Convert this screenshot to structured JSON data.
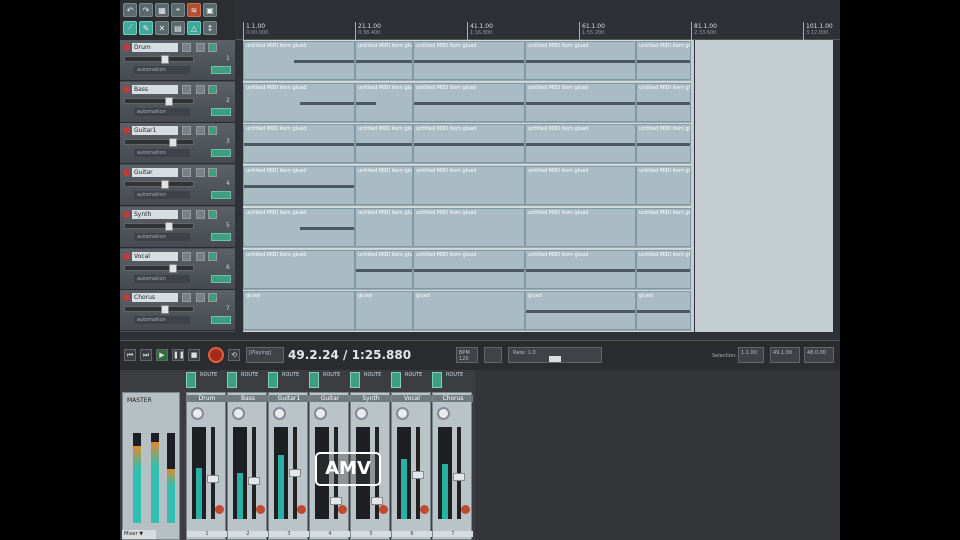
{
  "ruler": {
    "marks": [
      {
        "label": "1.1.00",
        "sub": "0:00.000"
      },
      {
        "label": "21.1.00",
        "sub": "0:38.400"
      },
      {
        "label": "41.1.00",
        "sub": "1:16.800"
      },
      {
        "label": "61.1.00",
        "sub": "1:55.200"
      },
      {
        "label": "81.1.00",
        "sub": "2:33.600"
      },
      {
        "label": "101.1.00",
        "sub": "3:12.000"
      }
    ]
  },
  "tracks": [
    {
      "name": "Drum",
      "num": "1",
      "io": "automation"
    },
    {
      "name": "Bass",
      "num": "2",
      "io": "automation"
    },
    {
      "name": "Guitar1",
      "num": "3",
      "io": "automation"
    },
    {
      "name": "Guitar",
      "num": "4",
      "io": "automation"
    },
    {
      "name": "Synth",
      "num": "5",
      "io": "automation"
    },
    {
      "name": "Vocal",
      "num": "6",
      "io": "automation"
    },
    {
      "name": "Chorus",
      "num": "7",
      "io": "automation"
    }
  ],
  "item_label": "untitled MIDI item glued",
  "chorus_item_label": "glued",
  "transport": {
    "time": "49.2.24 / 1:25.880",
    "state": "[Playing]",
    "bpm_label": "BPM 120",
    "rate_label": "Rate: 1.0",
    "selection_label": "Selection:",
    "selection_values": [
      "1.1.00",
      "49.1.00",
      "48.0.00"
    ]
  },
  "mixer": {
    "master_label": "MASTER",
    "strip_top_label": "ROUTE",
    "strips": [
      {
        "name": "Drum",
        "num": "1",
        "level": 0.55
      },
      {
        "name": "Bass",
        "num": "2",
        "level": 0.5
      },
      {
        "name": "Guitar1",
        "num": "3",
        "level": 0.7
      },
      {
        "name": "Guitar",
        "num": "4",
        "level": 0.0
      },
      {
        "name": "Synth",
        "num": "5",
        "level": 0.0
      },
      {
        "name": "Vocal",
        "num": "6",
        "level": 0.65
      },
      {
        "name": "Chorus",
        "num": "7",
        "level": 0.6
      }
    ],
    "master_levels": [
      0.85,
      0.9,
      0.6
    ]
  },
  "logo_text": "AMV",
  "status_tab": "Mixer ▼"
}
